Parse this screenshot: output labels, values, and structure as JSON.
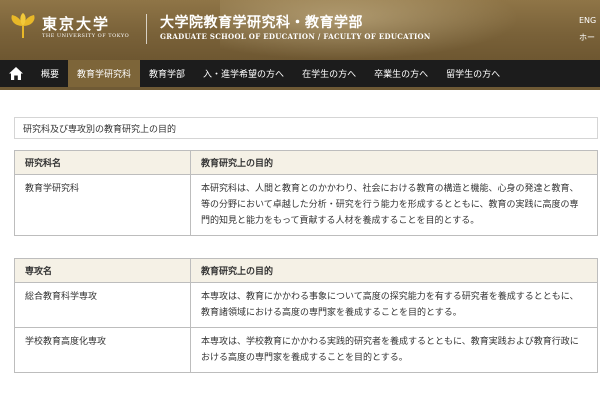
{
  "header": {
    "logo_main": "東京大学",
    "logo_sub": "THE UNIVERSITY OF TOKYO",
    "school_jp": "大学院教育学研究科・教育学部",
    "school_en": "GRADUATE SCHOOL OF EDUCATION / FACULTY OF EDUCATION",
    "lang_link": "ENG",
    "home_link": "ホー"
  },
  "nav": {
    "home_icon": "home-icon",
    "items": [
      {
        "label": "概要"
      },
      {
        "label": "教育学研究科"
      },
      {
        "label": "教育学部"
      },
      {
        "label": "入・進学希望の方へ"
      },
      {
        "label": "在学生の方へ"
      },
      {
        "label": "卒業生の方へ"
      },
      {
        "label": "留学生の方へ"
      }
    ],
    "active_index": 1
  },
  "content": {
    "section_title": "研究科及び専攻別の教育研究上の目的",
    "table1": {
      "headers": [
        "研究科名",
        "教育研究上の目的"
      ],
      "rows": [
        [
          "教育学研究科",
          "本研究科は、人間と教育とのかかわり、社会における教育の構造と機能、心身の発達と教育、等の分野において卓越した分析・研究を行う能力を形成するとともに、教育の実践に高度の専門的知見と能力をもって貢献する人材を養成することを目的とする。"
        ]
      ]
    },
    "table2": {
      "headers": [
        "専攻名",
        "教育研究上の目的"
      ],
      "rows": [
        [
          "総合教育科学専攻",
          "本専攻は、教育にかかわる事象について高度の探究能力を有する研究者を養成するとともに、教育諸領域における高度の専門家を養成することを目的とする。"
        ],
        [
          "学校教育高度化専攻",
          "本専攻は、学校教育にかかわる実践的研究者を養成するとともに、教育実践および教育行政における高度の専門家を養成することを目的とする。"
        ]
      ]
    }
  },
  "colors": {
    "header_brown": "#7a6239",
    "nav_black": "#1c1c1c",
    "nav_active": "#7d6539",
    "table_header_bg": "#f5f1e6",
    "logo_gold": "#e8b828"
  }
}
